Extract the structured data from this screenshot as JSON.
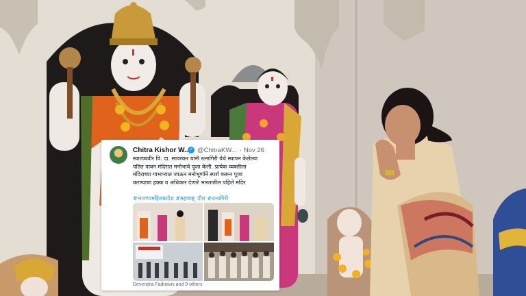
{
  "tweet": {
    "author_name": "Chitra Kishor W...",
    "handle": "@ChitraKW...",
    "date": "· Nov 26",
    "text": "स्वातंत्र्यवीर वि. दा. सावरकर यांनी रत्नागिरी येथे स्थापन केलेल्या\nपतित पावन मंदिरात मनोभावे पूजा केली. प्रत्येक व्यक्तीला\nमंदिराच्या गाभाऱ्यात जाऊन मनोभूर्णाने स्पर्श करून पूजा\nकरण्याचा हक्क व अधिकार देणारे भारतातील पहिले मंदिर",
    "hashtags": "#भाजपामहिलाप्रदेश #महाराष्ट्र_दौरा #रत्नागिरी",
    "tagged": "Devendra Fadnavis and 9 others"
  },
  "icons": {
    "verified": "verified-badge-icon"
  },
  "colors": {
    "link": "#1d9bf0",
    "muted": "#536471",
    "verified": "#1d9bf0"
  }
}
